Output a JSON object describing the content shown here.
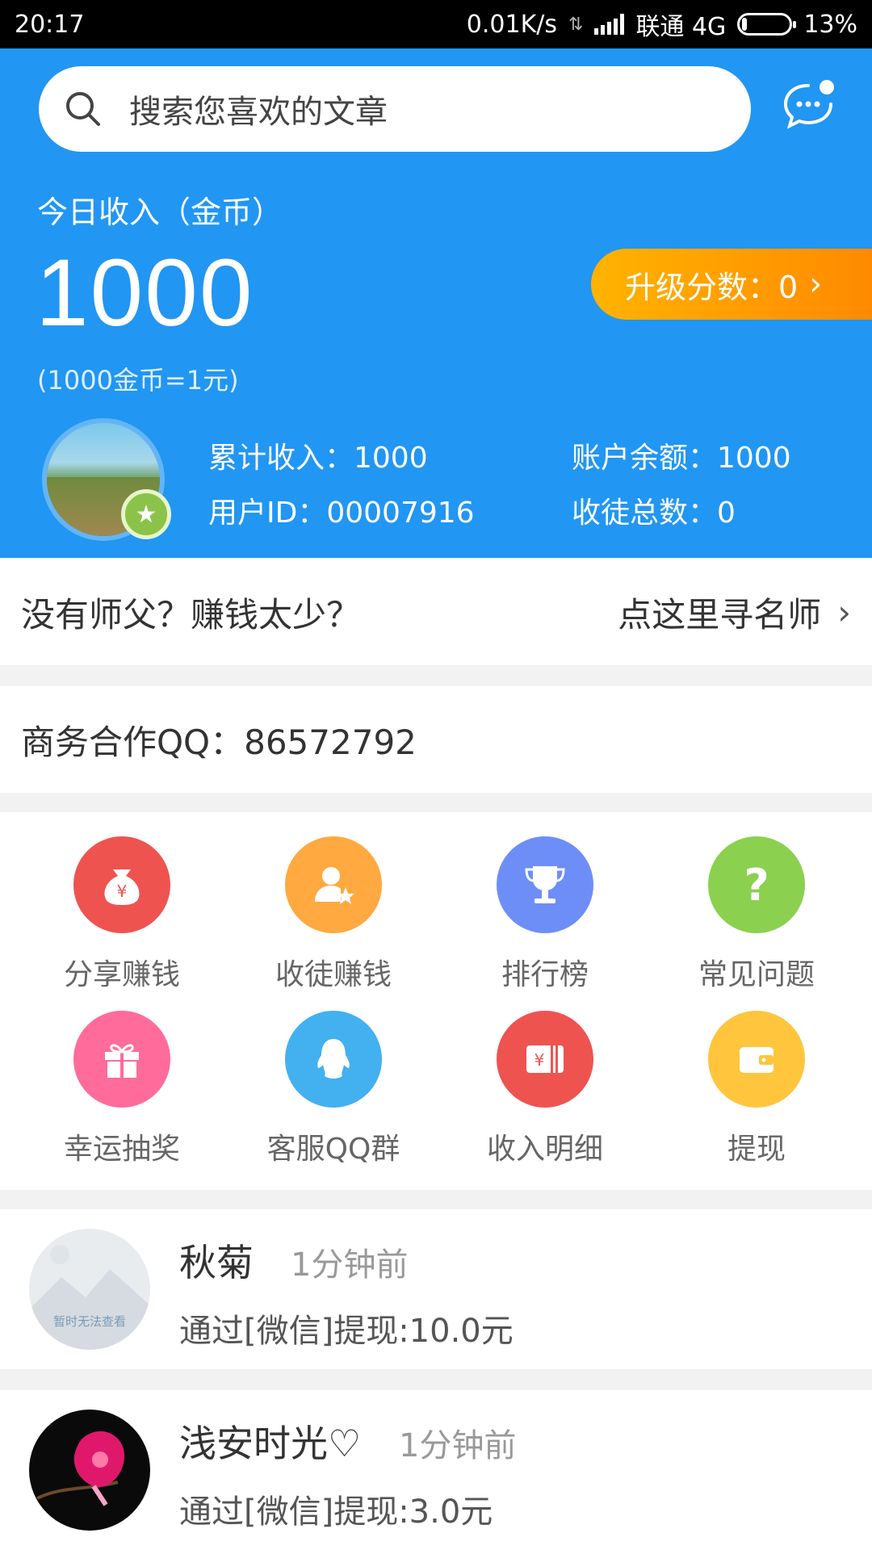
{
  "status": {
    "time": "20:17",
    "speed": "0.01K/s",
    "carrier": "联通 4G",
    "battery": "13%"
  },
  "search": {
    "placeholder": "搜索您喜欢的文章"
  },
  "summary": {
    "today_label": "今日收入（金币）",
    "today_income": "1000",
    "rate_note": "(1000金币=1元)",
    "upgrade_label": "升级分数：0",
    "total_income": "累计收入：1000",
    "balance": "账户余额：1000",
    "user_id": "用户ID：00007916",
    "disciples": "收徒总数：0"
  },
  "master_row": {
    "prompt": "没有师父？赚钱太少？",
    "link": "点这里寻名师"
  },
  "qq_row": {
    "text": "商务合作QQ：86572792"
  },
  "menu": [
    {
      "label": "分享赚钱",
      "icon": "money-bag-icon",
      "color": "#ef5350"
    },
    {
      "label": "收徒赚钱",
      "icon": "user-star-icon",
      "color": "#ffa940"
    },
    {
      "label": "排行榜",
      "icon": "trophy-icon",
      "color": "#6e8ef7"
    },
    {
      "label": "常见问题",
      "icon": "question-icon",
      "color": "#8bd04f"
    },
    {
      "label": "幸运抽奖",
      "icon": "gift-icon",
      "color": "#ff6b9a"
    },
    {
      "label": "客服QQ群",
      "icon": "qq-penguin-icon",
      "color": "#43b0f0"
    },
    {
      "label": "收入明细",
      "icon": "ledger-icon",
      "color": "#ef5350"
    },
    {
      "label": "提现",
      "icon": "wallet-icon",
      "color": "#ffc53d"
    }
  ],
  "feed": [
    {
      "name": "秋菊",
      "ago": "1分钟前",
      "desc": "通过[微信]提现:10.0元",
      "placeholder_text": "暂时无法查看"
    },
    {
      "name": "浅安时光♡",
      "ago": "1分钟前",
      "desc": "通过[微信]提现:3.0元"
    }
  ]
}
